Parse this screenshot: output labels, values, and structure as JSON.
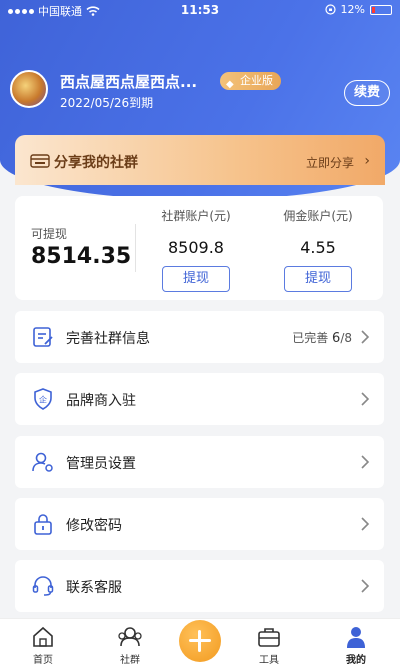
{
  "status_bar": {
    "carrier": "中国联通",
    "time": "11:53",
    "battery": "12%"
  },
  "profile": {
    "shop_name": "西点屋西点屋西点...",
    "badge": "企业版",
    "expire": "2022/05/26到期",
    "renew": "续费"
  },
  "share": {
    "title": "分享我的社群",
    "link": "立即分享"
  },
  "account": {
    "withdrawable_label": "可提现",
    "withdrawable_value": "8514.35",
    "community_label": "社群账户(元)",
    "community_value": "8509.8",
    "commission_label": "佣金账户(元)",
    "commission_value": "4.55",
    "withdraw": "提现"
  },
  "menu": [
    {
      "label": "完善社群信息",
      "icon": "edit-doc-icon",
      "status_prefix": "已完善",
      "status_done": "6",
      "status_total": "/8"
    },
    {
      "label": "品牌商入驻",
      "icon": "shield-enterprise-icon"
    },
    {
      "label": "管理员设置",
      "icon": "user-gear-icon"
    },
    {
      "label": "修改密码",
      "icon": "lock-icon"
    },
    {
      "label": "联系客服",
      "icon": "headset-icon"
    }
  ],
  "tabbar": [
    {
      "label": "首页",
      "icon": "home-icon"
    },
    {
      "label": "社群",
      "icon": "community-icon"
    },
    {
      "label": "",
      "icon": "plus-icon"
    },
    {
      "label": "工具",
      "icon": "toolbox-icon"
    },
    {
      "label": "我的",
      "icon": "person-icon",
      "active": true
    }
  ],
  "colors": {
    "primary": "#4b72e8",
    "accent": "#f29a1f",
    "share_text": "#6b3d18"
  }
}
